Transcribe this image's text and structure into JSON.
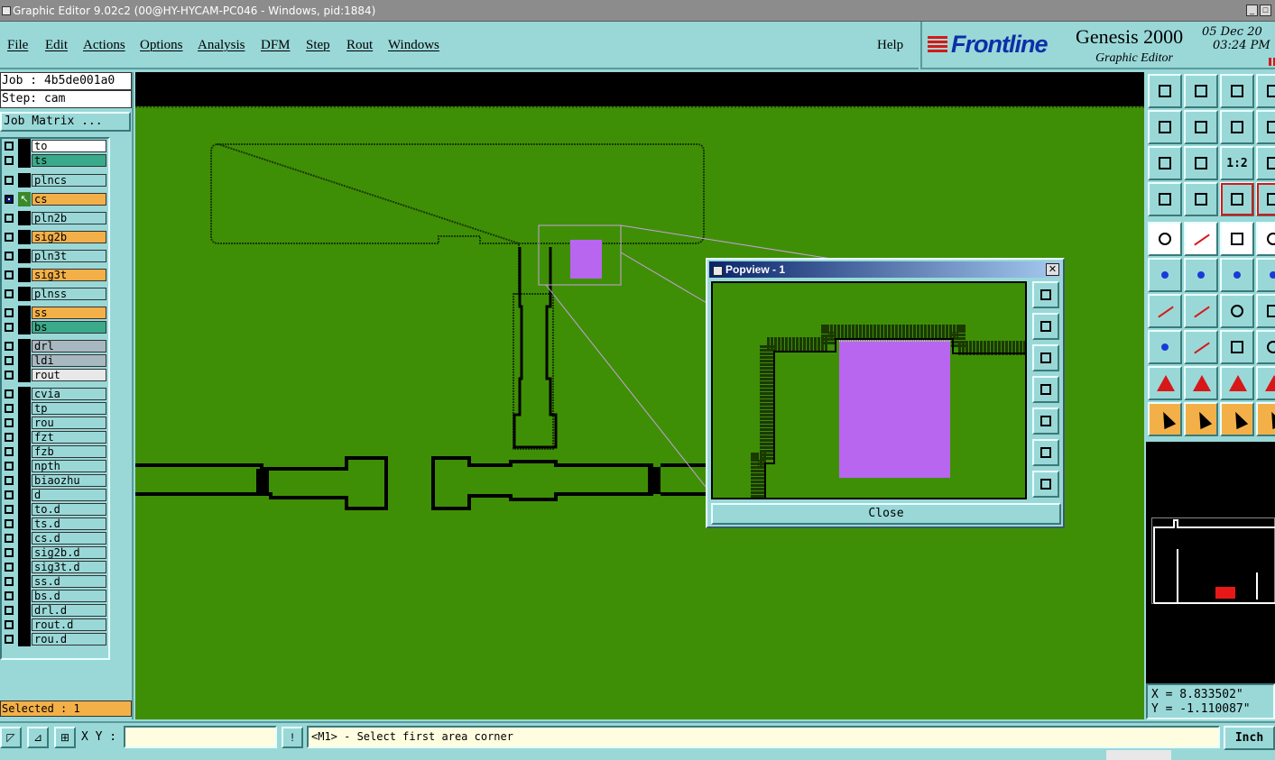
{
  "window": {
    "title": "Graphic Editor 9.02c2 (00@HY-HYCAM-PC046 - Windows, pid:1884)"
  },
  "menu": {
    "items": [
      "File",
      "Edit",
      "Actions",
      "Options",
      "Analysis",
      "DFM",
      "Step",
      "Rout",
      "Windows"
    ],
    "help": "Help"
  },
  "logo": {
    "brand": "Frontline",
    "product": "Genesis 2000",
    "subtitle": "Graphic Editor",
    "date": "05 Dec 20",
    "time": "03:24 PM"
  },
  "job": {
    "job_label": "Job : 4b5de001a0",
    "step_label": "Step: cam",
    "matrix_button": "Job Matrix ..."
  },
  "layers": [
    {
      "name": "to",
      "color": "white"
    },
    {
      "name": "ts",
      "color": "teal"
    },
    {
      "name": "plncs",
      "color": "default"
    },
    {
      "name": "cs",
      "color": "orange",
      "selected": true
    },
    {
      "name": "pln2b",
      "color": "default"
    },
    {
      "name": "sig2b",
      "color": "orange"
    },
    {
      "name": "pln3t",
      "color": "default"
    },
    {
      "name": "sig3t",
      "color": "orange"
    },
    {
      "name": "plnss",
      "color": "default"
    },
    {
      "name": "ss",
      "color": "orange"
    },
    {
      "name": "bs",
      "color": "teal"
    },
    {
      "name": "drl",
      "color": "grey"
    },
    {
      "name": "ldi",
      "color": "grey"
    },
    {
      "name": "rout",
      "color": "lgrey"
    },
    {
      "name": "cvia",
      "color": "default"
    },
    {
      "name": "tp",
      "color": "default"
    },
    {
      "name": "rou",
      "color": "default"
    },
    {
      "name": "fzt",
      "color": "default"
    },
    {
      "name": "fzb",
      "color": "default"
    },
    {
      "name": "npth",
      "color": "default"
    },
    {
      "name": "biaozhu",
      "color": "default"
    },
    {
      "name": "d",
      "color": "default"
    },
    {
      "name": "to.d",
      "color": "default"
    },
    {
      "name": "ts.d",
      "color": "default"
    },
    {
      "name": "cs.d",
      "color": "default"
    },
    {
      "name": "sig2b.d",
      "color": "default"
    },
    {
      "name": "sig3t.d",
      "color": "default"
    },
    {
      "name": "ss.d",
      "color": "default"
    },
    {
      "name": "bs.d",
      "color": "default"
    },
    {
      "name": "drl.d",
      "color": "default"
    },
    {
      "name": "rout.d",
      "color": "default"
    },
    {
      "name": "rou.d",
      "color": "default"
    }
  ],
  "selected_label": "Selected : 1",
  "popview": {
    "title": "Popview - 1",
    "close_label": "Close"
  },
  "coords": {
    "x": "X = 8.833502\"",
    "y": "Y = -1.110087\""
  },
  "status": {
    "xy_label": "X Y :",
    "xy_value": "",
    "prompt": "<M1> - Select first area corner",
    "unit": "Inch"
  },
  "colors": {
    "canvas": "#3f8f06",
    "feature": "#b866f0",
    "ui_bg": "#9ad8d8",
    "highlight": "#f4b048"
  }
}
